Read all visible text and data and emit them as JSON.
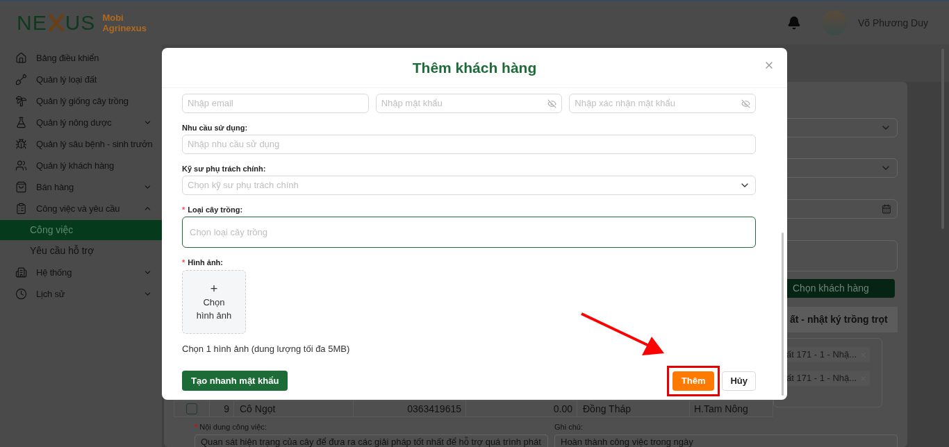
{
  "header": {
    "logo": {
      "left": "NE",
      "right": "US",
      "line1": "Mobi",
      "line2": "Agrinexus"
    },
    "user": {
      "name": "Võ Phương Duy"
    }
  },
  "sidebar": {
    "items": [
      {
        "label": "Bảng điều khiển",
        "kind": "link"
      },
      {
        "label": "Quản lý loại đất",
        "kind": "link"
      },
      {
        "label": "Quản lý giống cây trồng",
        "kind": "link"
      },
      {
        "label": "Quản lý nông dược",
        "kind": "group",
        "expanded": false
      },
      {
        "label": "Quản lý sâu bệnh - sinh trưởn",
        "kind": "link"
      },
      {
        "label": "Quản lý khách hàng",
        "kind": "link"
      },
      {
        "label": "Bán hàng",
        "kind": "group",
        "expanded": false
      },
      {
        "label": "Công việc và yêu cầu",
        "kind": "group",
        "expanded": true,
        "children": [
          {
            "label": "Công việc",
            "selected": true
          },
          {
            "label": "Yêu cầu hỗ trợ",
            "selected": false
          }
        ]
      },
      {
        "label": "Hệ thống",
        "kind": "group",
        "expanded": false
      },
      {
        "label": "Lịch sử",
        "kind": "group",
        "expanded": false
      }
    ]
  },
  "background": {
    "choose_customer_button": "Chọn khách hàng",
    "table_header": "ất - nhật ký trồng trọt",
    "tags": [
      "ất 171 - 1 - Nhậ...",
      "ất 171 - 1 - Nhậ..."
    ],
    "row": {
      "checked": false,
      "cells": [
        "9",
        "Cô Ngọt",
        "0363419615",
        "0.00",
        "Đồng Tháp",
        "H.Tam Nông"
      ]
    },
    "content_label": "Nội dung công việc:",
    "content_required": true,
    "content_value": "Quan sát hiện trạng của cây để đưa ra các giải pháp tốt nhất để hỗ trợ quá trình phát",
    "note_label": "Ghi chú:",
    "note_value": "Hoàn thành công việc trong ngày"
  },
  "modal": {
    "title": "Thêm khách hàng",
    "top_fields": [
      {
        "placeholder": "Nhập email",
        "kind": "text"
      },
      {
        "placeholder": "Nhập mật khẩu",
        "kind": "password"
      },
      {
        "placeholder": "Nhập xác nhận mật khẩu",
        "kind": "password"
      }
    ],
    "fields": [
      {
        "label": "Nhu cầu sử dụng:",
        "placeholder": "Nhập nhu cầu sử dụng",
        "kind": "text",
        "required": false,
        "focused": false
      },
      {
        "label": "Kỹ sư phụ trách chính:",
        "placeholder": "Chọn kỹ sư phụ trách chính",
        "kind": "select",
        "required": false,
        "focused": false
      },
      {
        "label": "Loại cây trồng:",
        "placeholder": "Chọn loại cây trồng",
        "kind": "tags",
        "required": true,
        "focused": true
      }
    ],
    "image": {
      "label": "Hình ảnh:",
      "required": true,
      "plus": "+",
      "upload_text": "Chọn hình ảnh",
      "hint": "Chọn 1 hình ảnh (dung lượng tối đa 5MB)"
    },
    "quick_password_button": "Tạo nhanh mật khẩu",
    "submit_button": "Thêm",
    "cancel_button": "Hủy",
    "submit_highlighted": true
  },
  "required_mark": "*"
}
